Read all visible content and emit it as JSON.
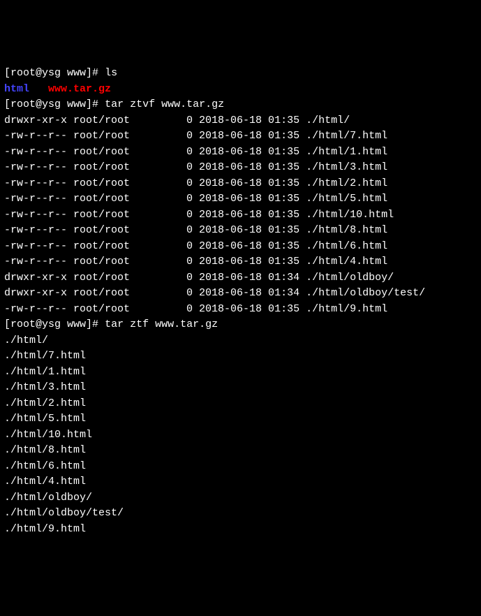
{
  "prompt1": {
    "open": "[",
    "userhost": "root@ysg www",
    "close": "]# ",
    "command": "ls"
  },
  "ls_output": {
    "dir": "html",
    "spacer": "   ",
    "archive": "www.tar.gz"
  },
  "prompt2": {
    "open": "[",
    "userhost": "root@ysg www",
    "close": "]# ",
    "command": "tar ztvf www.tar.gz"
  },
  "ztvf_lines": [
    "drwxr-xr-x root/root         0 2018-06-18 01:35 ./html/",
    "-rw-r--r-- root/root         0 2018-06-18 01:35 ./html/7.html",
    "-rw-r--r-- root/root         0 2018-06-18 01:35 ./html/1.html",
    "-rw-r--r-- root/root         0 2018-06-18 01:35 ./html/3.html",
    "-rw-r--r-- root/root         0 2018-06-18 01:35 ./html/2.html",
    "-rw-r--r-- root/root         0 2018-06-18 01:35 ./html/5.html",
    "-rw-r--r-- root/root         0 2018-06-18 01:35 ./html/10.html",
    "-rw-r--r-- root/root         0 2018-06-18 01:35 ./html/8.html",
    "-rw-r--r-- root/root         0 2018-06-18 01:35 ./html/6.html",
    "-rw-r--r-- root/root         0 2018-06-18 01:35 ./html/4.html",
    "drwxr-xr-x root/root         0 2018-06-18 01:34 ./html/oldboy/",
    "drwxr-xr-x root/root         0 2018-06-18 01:34 ./html/oldboy/test/",
    "-rw-r--r-- root/root         0 2018-06-18 01:35 ./html/9.html"
  ],
  "prompt3": {
    "open": "[",
    "userhost": "root@ysg www",
    "close": "]# ",
    "command": "tar ztf www.tar.gz"
  },
  "ztf_lines": [
    "./html/",
    "./html/7.html",
    "./html/1.html",
    "./html/3.html",
    "./html/2.html",
    "./html/5.html",
    "./html/10.html",
    "./html/8.html",
    "./html/6.html",
    "./html/4.html",
    "./html/oldboy/",
    "./html/oldboy/test/",
    "./html/9.html"
  ]
}
